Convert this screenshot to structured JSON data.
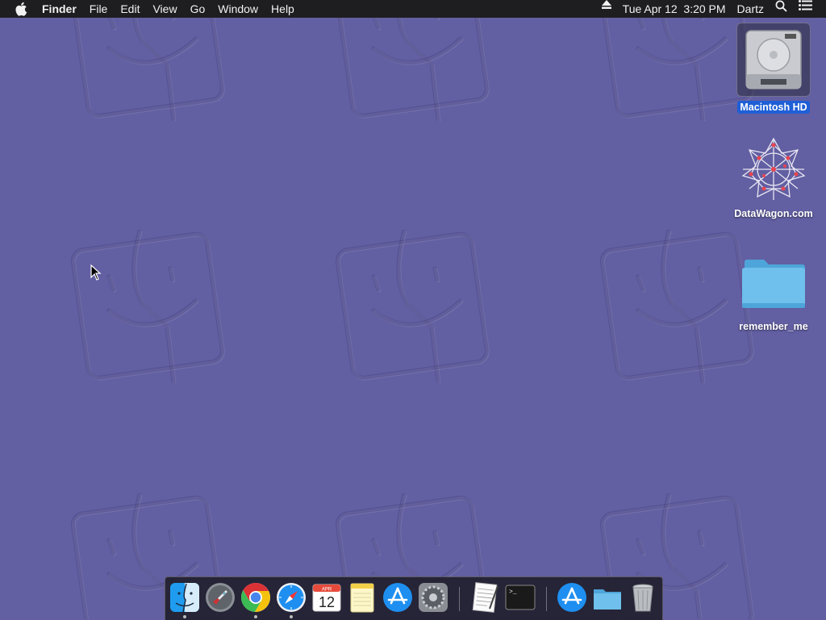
{
  "menubar": {
    "app_name": "Finder",
    "menus": [
      "File",
      "Edit",
      "View",
      "Go",
      "Window",
      "Help"
    ],
    "clock": "Tue Apr 12  3:20 PM",
    "user": "Dartz",
    "icons": [
      "apple-icon",
      "eject-icon",
      "spotlight-search-icon",
      "notification-center-icon"
    ]
  },
  "desktop": {
    "icons": [
      {
        "label": "Macintosh HD",
        "selected": true,
        "icon": "hard-drive-icon"
      },
      {
        "label": "DataWagon.com",
        "selected": false,
        "icon": "datawagon-logo-icon"
      },
      {
        "label": "remember_me",
        "selected": false,
        "icon": "folder-icon"
      }
    ],
    "wallpaper_color": "#625fa2"
  },
  "dock": {
    "calendar": {
      "month": "APR",
      "day": "12"
    },
    "items": [
      "finder",
      "launchpad",
      "chrome",
      "safari",
      "calendar",
      "notes",
      "app-store",
      "system-preferences",
      "textedit",
      "terminal",
      "app-store-downloads",
      "folder",
      "trash"
    ],
    "running": [
      "finder",
      "chrome",
      "safari"
    ]
  },
  "colors": {
    "menubar": "#1e1e20",
    "selection": "#1f5fd6",
    "folder": "#5ab4e6"
  }
}
